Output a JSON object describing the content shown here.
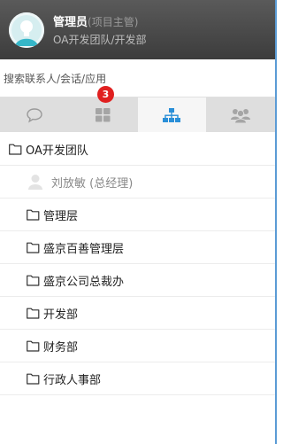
{
  "user": {
    "name": "管理员",
    "role": "(项目主管)",
    "dept": "OA开发团队/开发部"
  },
  "search": {
    "placeholder": "搜索联系人/会话/应用"
  },
  "tabs": [
    {
      "icon": "chat-bubble-icon",
      "active": false
    },
    {
      "icon": "apps-grid-icon",
      "active": false,
      "badge": "3"
    },
    {
      "icon": "org-chart-icon",
      "active": true
    },
    {
      "icon": "group-users-icon",
      "active": false
    }
  ],
  "colors": {
    "header": "#4a4a4a",
    "tab_bar": "#dedede",
    "active_tab": "#f6f6f6",
    "accent": "#2a8fd8",
    "badge": "#e02020"
  },
  "tree": {
    "root": "OA开发团队",
    "member": "刘放敏 (总经理)",
    "groups": [
      "管理层",
      "盛京百善管理层",
      "盛京公司总裁办",
      "开发部",
      "财务部",
      "行政人事部"
    ]
  }
}
